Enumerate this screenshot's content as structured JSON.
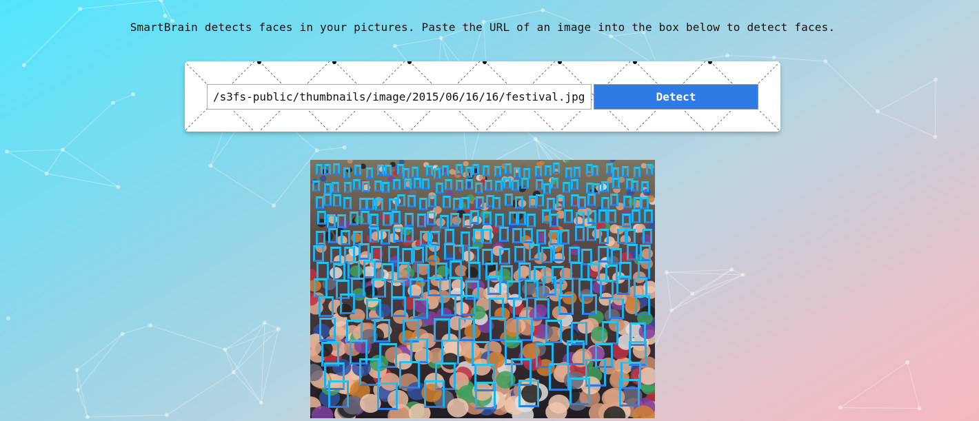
{
  "intro_text": "SmartBrain detects faces in your pictures. Paste the URL of an image into the box below to detect faces.",
  "url_input": {
    "value": "/s3fs-public/thumbnails/image/2015/06/16/16/festival.jpg"
  },
  "detect_button": {
    "label": "Detect"
  },
  "colors": {
    "accent": "#2f7be6",
    "face_box": "#1fb0f0"
  },
  "photo": {
    "description_icon": "crowd-photo-image"
  }
}
